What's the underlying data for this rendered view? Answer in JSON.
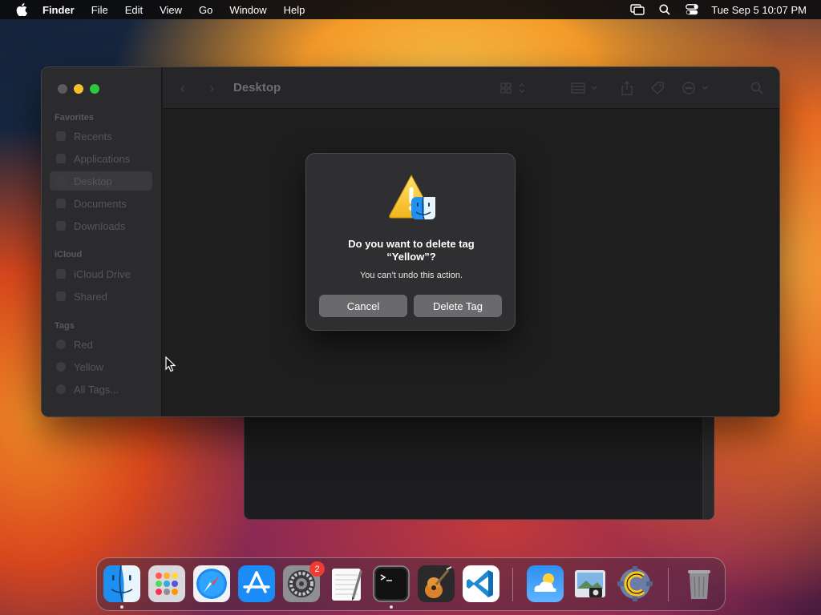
{
  "menubar": {
    "app_name": "Finder",
    "items": [
      "File",
      "Edit",
      "View",
      "Go",
      "Window",
      "Help"
    ],
    "clock": "Tue Sep 5  10:07 PM",
    "status_icons": [
      "screen-mirroring-icon",
      "spotlight-search-icon",
      "control-center-icon"
    ]
  },
  "finder": {
    "title": "Desktop",
    "sidebar": {
      "sections": {
        "favorites": "Favorites",
        "icloud": "iCloud",
        "tags": "Tags"
      },
      "favorites": [
        "Recents",
        "Applications",
        "Desktop",
        "Documents",
        "Downloads"
      ],
      "icloud": [
        "iCloud Drive",
        "Shared"
      ],
      "tags": [
        "Red",
        "Yellow",
        "All Tags..."
      ],
      "selected": "Desktop"
    }
  },
  "dialog": {
    "heading": "Do you want to delete tag “Yellow”?",
    "message": "You can’t undo this action.",
    "cancel_label": "Cancel",
    "confirm_label": "Delete Tag"
  },
  "dock": {
    "apps": [
      "Finder",
      "Launchpad",
      "Safari",
      "App Store",
      "System Settings",
      "TextEdit",
      "Terminal",
      "GarageBand",
      "Visual Studio Code",
      "Weather",
      "Preview",
      "CotEditor",
      "Trash"
    ],
    "system_settings_badge": "2"
  },
  "colors": {
    "traffic_close": "#5b5b5d",
    "traffic_minimize": "#f5bd2f",
    "traffic_maximize": "#2dc840",
    "badge": "#ef3b30"
  }
}
